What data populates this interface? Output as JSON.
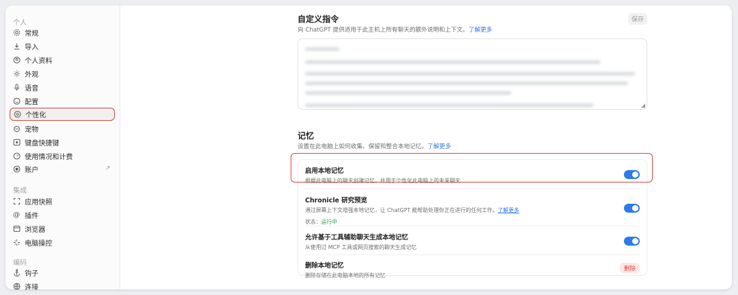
{
  "sidebar": {
    "groups": [
      {
        "header": "个人",
        "items": [
          {
            "label": "常规",
            "icon": "gear-icon"
          },
          {
            "label": "导入",
            "icon": "download-icon"
          },
          {
            "label": "个人资料",
            "icon": "user-circle-icon"
          },
          {
            "label": "外观",
            "icon": "sun-icon"
          },
          {
            "label": "语音",
            "icon": "microphone-icon"
          },
          {
            "label": "配置",
            "icon": "smile-icon"
          },
          {
            "label": "个性化",
            "icon": "personalization-icon",
            "active": true
          },
          {
            "label": "宠物",
            "icon": "pet-icon"
          },
          {
            "label": "键盘快捷键",
            "icon": "keyboard-icon"
          },
          {
            "label": "使用情况和计费",
            "icon": "gauge-icon"
          },
          {
            "label": "账户",
            "icon": "account-icon",
            "external_icon": "external-arrow-icon"
          }
        ]
      },
      {
        "header": "集成",
        "items": [
          {
            "label": "应用快照",
            "icon": "snapshot-icon"
          },
          {
            "label": "插件",
            "icon": "at-icon"
          },
          {
            "label": "浏览器",
            "icon": "browser-icon"
          },
          {
            "label": "电脑操控",
            "icon": "sparkle-icon"
          }
        ]
      },
      {
        "header": "编码",
        "items": [
          {
            "label": "钩子",
            "icon": "anchor-icon"
          },
          {
            "label": "连接",
            "icon": "globe-icon"
          }
        ]
      }
    ]
  },
  "custom_instructions": {
    "title": "自定义指令",
    "description": "向 ChatGPT 提供适用于此主机上所有聊天的额外说明和上下文。",
    "learn_more": "了解更多",
    "save_label": "保存"
  },
  "memory": {
    "title": "记忆",
    "description": "设置在此电脑上如何收集、保留和整合本地记忆。",
    "learn_more": "了解更多",
    "rows": [
      {
        "title": "启用本地记忆",
        "desc": "根据此电脑上的聊天创建记忆，并用于个性化此电脑上的未来聊天",
        "control": "toggle",
        "on": true
      },
      {
        "title": "Chronicle 研究预览",
        "desc": "通过屏幕上下文增强本地记忆，让 ChatGPT 能帮助处理你正在进行的任何工作。",
        "learn_more": "了解更多",
        "status_label": "状态：",
        "status_value": "运行中",
        "control": "toggle",
        "on": true
      },
      {
        "title": "允许基于工具辅助聊天生成本地记忆",
        "desc": "从使用过 MCP 工具或网页搜索的聊天生成记忆",
        "control": "toggle",
        "on": true
      },
      {
        "title": "删除本地记忆",
        "desc": "删除存储在此电脑本地的所有记忆",
        "control": "button",
        "button_label": "删除"
      }
    ]
  },
  "colors": {
    "accent": "#2f7ae5",
    "highlight": "#d9463b",
    "status_ok": "#2c9a4a",
    "danger_bg": "#fde8e6"
  }
}
